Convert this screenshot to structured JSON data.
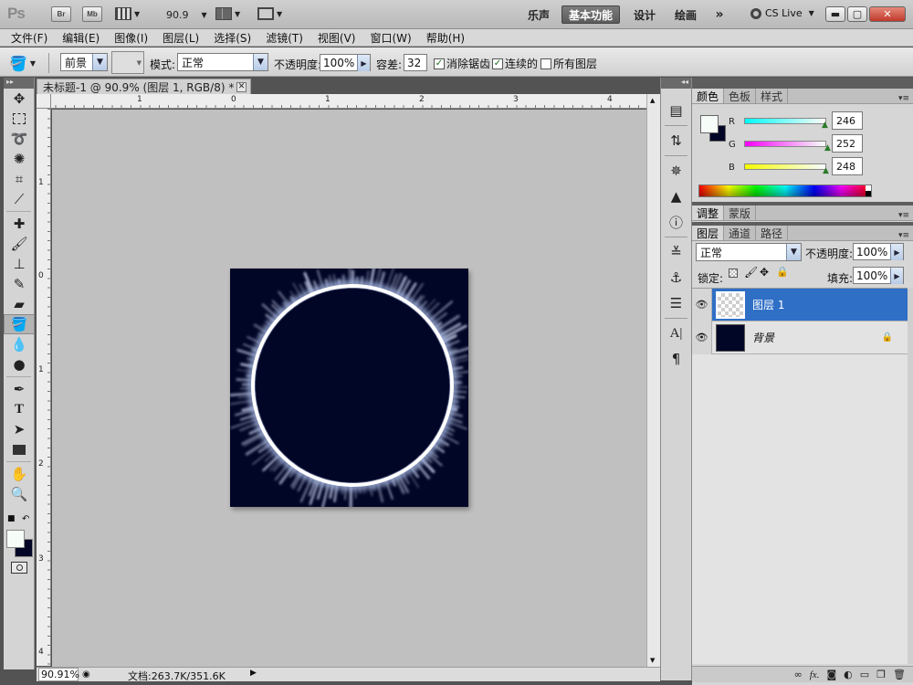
{
  "appbar": {
    "logo": "Ps",
    "br": "Br",
    "mb": "Mb",
    "zoom": "90.9",
    "workspaces": [
      "乐声",
      "基本功能",
      "设计",
      "绘画"
    ],
    "more": "»",
    "cslive": "CS Live"
  },
  "menu": [
    "文件(F)",
    "编辑(E)",
    "图像(I)",
    "图层(L)",
    "选择(S)",
    "滤镜(T)",
    "视图(V)",
    "窗口(W)",
    "帮助(H)"
  ],
  "options": {
    "fill_source": "前景",
    "mode_label": "模式:",
    "mode": "正常",
    "opacity_label": "不透明度:",
    "opacity": "100%",
    "tolerance_label": "容差:",
    "tolerance": "32",
    "antialias": "消除锯齿",
    "contiguous": "连续的",
    "all_layers": "所有图层"
  },
  "document": {
    "tab_title": "未标题-1 @ 90.9% (图层 1, RGB/8) *",
    "ruler_h": [
      "1",
      "0",
      "1",
      "2",
      "3",
      "4"
    ],
    "ruler_v": [
      "1",
      "0",
      "1",
      "2",
      "3",
      "4"
    ],
    "status_zoom": "90.91%",
    "status_doc": "文档:263.7K/351.6K",
    "canvas_color": "#020626"
  },
  "color_panel": {
    "tabs": [
      "颜色",
      "色板",
      "样式"
    ],
    "r_label": "R",
    "g_label": "G",
    "b_label": "B",
    "r": "246",
    "g": "252",
    "b": "248",
    "fg_color": "#f6fcf8",
    "bg_color": "#020626"
  },
  "adjust_panel": {
    "tabs": [
      "调整",
      "蒙版"
    ]
  },
  "layers_panel": {
    "tabs": [
      "图层",
      "通道",
      "路径"
    ],
    "blend_mode": "正常",
    "opacity_label": "不透明度:",
    "opacity": "100%",
    "lock_label": "锁定:",
    "fill_label": "填充:",
    "fill": "100%",
    "layers": [
      {
        "name": "图层 1",
        "selected": true
      },
      {
        "name": "背景",
        "selected": false
      }
    ]
  },
  "accent_color": "#2f6fc6"
}
